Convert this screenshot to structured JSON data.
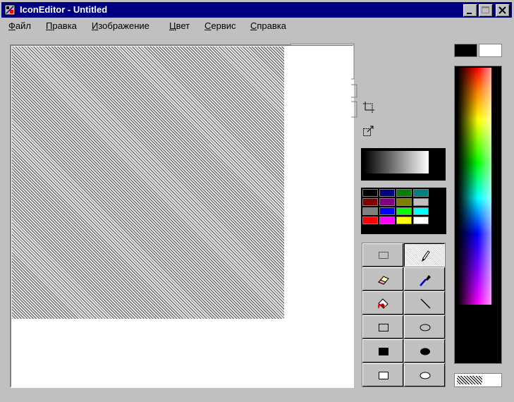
{
  "window": {
    "title": "IconEditor - Untitled",
    "title_bar_color": "#000080"
  },
  "menu": {
    "items": [
      {
        "first": "Ф",
        "rest": "айл"
      },
      {
        "first": "П",
        "rest": "равка"
      },
      {
        "first": "И",
        "rest": "зображение"
      },
      {
        "first": "Ц",
        "rest": "вет"
      },
      {
        "first": "С",
        "rest": "ервис"
      },
      {
        "first": "С",
        "rest": "правка"
      }
    ]
  },
  "colors": {
    "foreground": "#000000",
    "background": "#ffffff"
  },
  "palette": [
    "#000000",
    "#000080",
    "#008000",
    "#008080",
    "#800000",
    "#800080",
    "#808000",
    "#c0c0c0",
    "#808080",
    "#0000ff",
    "#00ff00",
    "#00ffff",
    "#ff0000",
    "#ff00ff",
    "#ffff00",
    "#ffffff"
  ],
  "tools": [
    {
      "name": "select-rect-tool",
      "icon": "dotted-rect-icon"
    },
    {
      "name": "pencil-tool",
      "icon": "pencil-icon",
      "active": true
    },
    {
      "name": "eraser-tool",
      "icon": "eraser-icon"
    },
    {
      "name": "eyedropper-tool",
      "icon": "eyedropper-icon"
    },
    {
      "name": "fill-tool",
      "icon": "paint-bucket-icon"
    },
    {
      "name": "line-tool",
      "icon": "line-icon"
    },
    {
      "name": "rect-outline-tool",
      "icon": "rect-outline-icon"
    },
    {
      "name": "ellipse-outline-tool",
      "icon": "ellipse-outline-icon"
    },
    {
      "name": "rect-filled-tool",
      "icon": "rect-filled-icon"
    },
    {
      "name": "ellipse-filled-tool",
      "icon": "ellipse-filled-icon"
    },
    {
      "name": "rect-white-tool",
      "icon": "rect-white-icon"
    },
    {
      "name": "ellipse-white-tool",
      "icon": "ellipse-white-icon"
    }
  ]
}
